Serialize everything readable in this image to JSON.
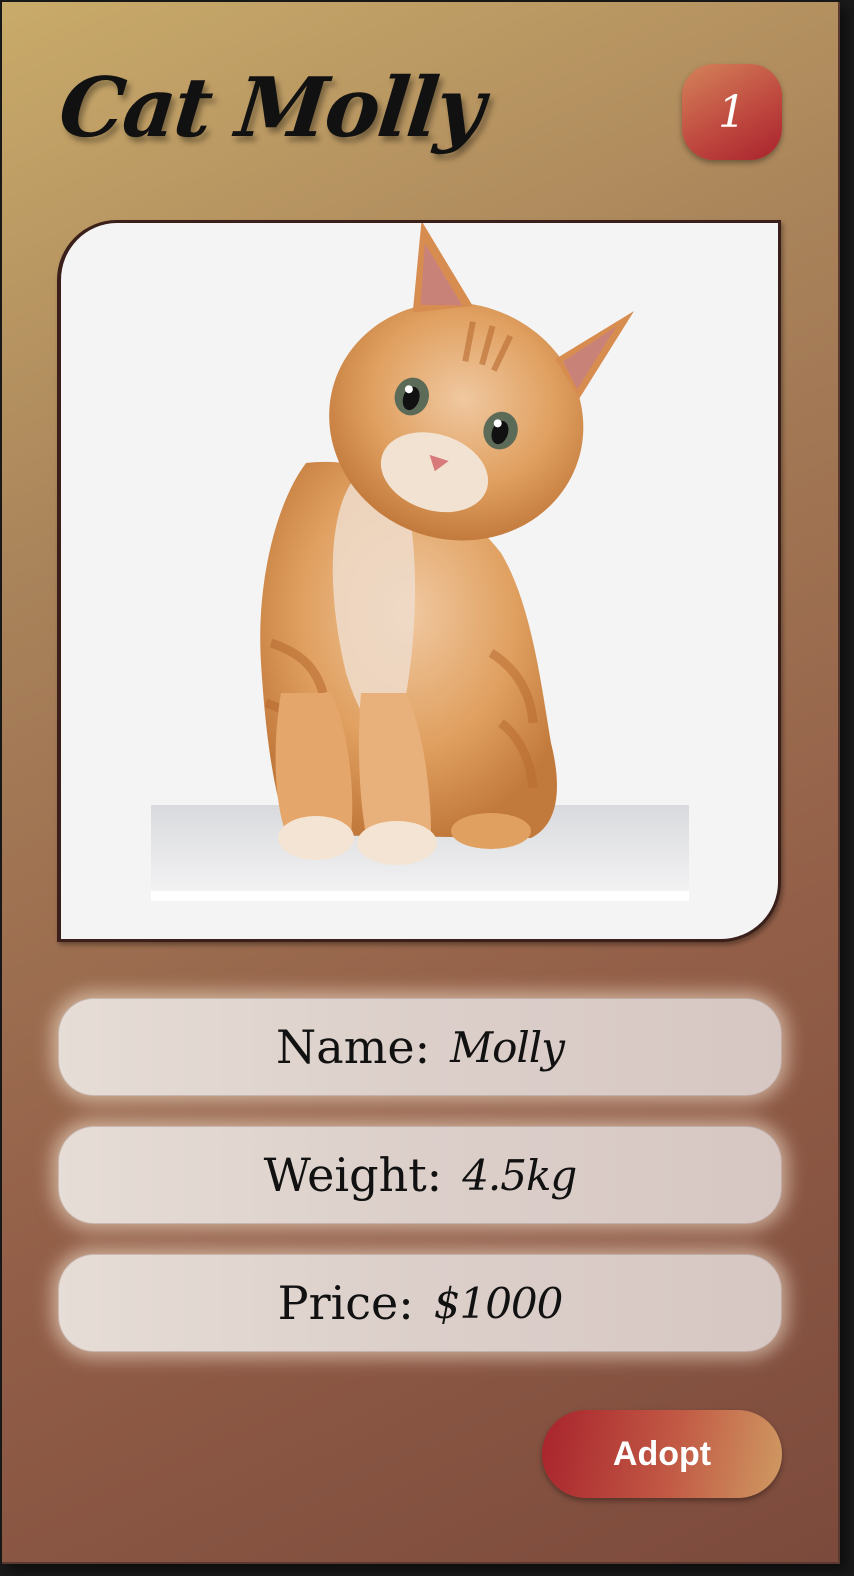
{
  "header": {
    "title": "Cat Molly",
    "count_badge": "1"
  },
  "photo": {
    "description_icon": "orange-kitten-image"
  },
  "details": {
    "name_label": "Name:",
    "name_value": "Molly",
    "weight_label": "Weight:",
    "weight_value": "4.5kg",
    "price_label": "Price:",
    "price_value": "$1000"
  },
  "actions": {
    "adopt_label": "Adopt"
  },
  "colors": {
    "card_start": "#c9ab6a",
    "card_end": "#7c4a3c",
    "accent_red": "#a9222c",
    "field_bg": "#dccfca"
  }
}
